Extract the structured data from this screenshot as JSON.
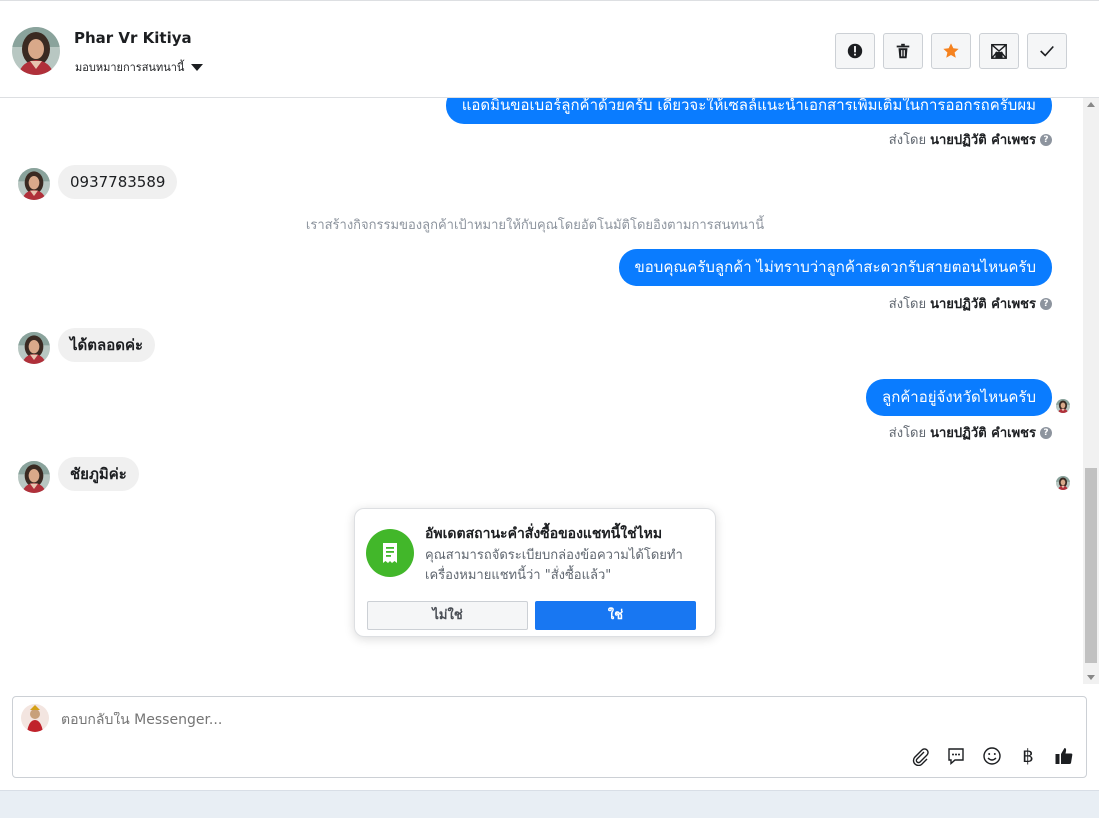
{
  "header": {
    "contact_name": "Phar Vr Kitiya",
    "assign_label": "มอบหมายการสนทนานี้",
    "buttons": [
      {
        "name": "spam-button",
        "icon": "alert-icon"
      },
      {
        "name": "delete-button",
        "icon": "trash-icon"
      },
      {
        "name": "star-button",
        "icon": "star-icon",
        "color": "#f5821f"
      },
      {
        "name": "mark-unread-button",
        "icon": "envelope-icon"
      },
      {
        "name": "done-button",
        "icon": "check-icon"
      }
    ]
  },
  "thread": {
    "messages": [
      {
        "dir": "out",
        "text": "แอดมินขอเบอร์ลูกค้าด้วยครับ เดี๋ยวจะให้เซลล์แนะนำเอกสารเพิ่มเติมในการออกรถครับผม",
        "sent_by_prefix": "ส่งโดย",
        "sent_by_name": "นายปฏิวัติ คำเพชร"
      },
      {
        "dir": "in",
        "text": "0937783589"
      },
      {
        "dir": "system",
        "text": "เราสร้างกิจกรรมของลูกค้าเป้าหมายให้กับคุณโดยอัตโนมัติโดยอิงตามการสนทนานี้"
      },
      {
        "dir": "out",
        "text": "ขอบคุณครับลูกค้า ไม่ทราบว่าลูกค้าสะดวกรับสายตอนไหนครับ",
        "sent_by_prefix": "ส่งโดย",
        "sent_by_name": "นายปฏิวัติ คำเพชร"
      },
      {
        "dir": "in",
        "text": "ได้ตลอดค่ะ"
      },
      {
        "dir": "out",
        "text": "ลูกค้าอยู่จังหวัดไหนครับ",
        "sent_by_prefix": "ส่งโดย",
        "sent_by_name": "นายปฏิวัติ คำเพชร"
      },
      {
        "dir": "in",
        "text": "ชัยภูมิค่ะ"
      }
    ]
  },
  "popup": {
    "title": "อัพเดตสถานะคำสั่งซื้อของแชทนี้ใช่ไหม",
    "description": "คุณสามารถจัดระเบียบกล่องข้อความได้โดยทำเครื่องหมายแชทนี้ว่า \"สั่งซื้อแล้ว\"",
    "no_label": "ไม่ใช่",
    "yes_label": "ใช่",
    "icon": "receipt-icon",
    "icon_bg": "#42b72a"
  },
  "composer": {
    "placeholder": "ตอบกลับใน Messenger...",
    "tools": [
      "attach-icon",
      "saved-reply-icon",
      "emoji-icon",
      "baht-icon",
      "like-icon"
    ],
    "baht_symbol": "฿"
  },
  "colors": {
    "outgoing_bubble": "#0a7cff",
    "incoming_bubble": "#f0f0f0",
    "primary_button": "#1877f2"
  }
}
